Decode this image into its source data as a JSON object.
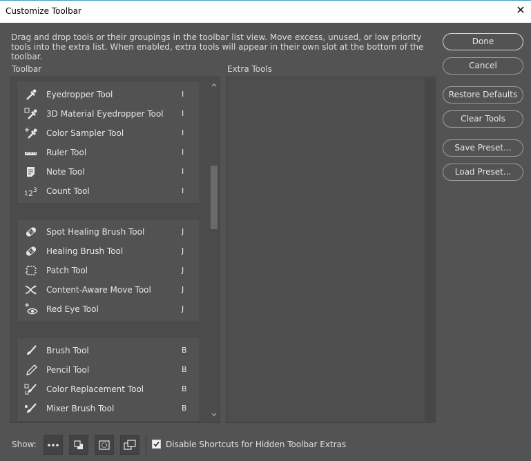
{
  "window": {
    "title": "Customize Toolbar",
    "close_glyph": "✕"
  },
  "description": "Drag and drop tools or their groupings in the toolbar list view. Move excess, unused, or low priority tools into the extra list. When enabled, extra tools will appear in their own slot at the bottom of the toolbar.",
  "panels": {
    "toolbar_label": "Toolbar",
    "extra_label": "Extra Tools"
  },
  "groups": [
    {
      "tools": [
        {
          "name": "Eyedropper Tool",
          "key": "I",
          "icon": "eyedropper-icon"
        },
        {
          "name": "3D Material Eyedropper Tool",
          "key": "I",
          "icon": "3d-material-eyedropper-icon"
        },
        {
          "name": "Color Sampler Tool",
          "key": "I",
          "icon": "color-sampler-icon"
        },
        {
          "name": "Ruler Tool",
          "key": "I",
          "icon": "ruler-icon"
        },
        {
          "name": "Note Tool",
          "key": "I",
          "icon": "note-icon"
        },
        {
          "name": "Count Tool",
          "key": "I",
          "icon": "count-icon"
        }
      ]
    },
    {
      "tools": [
        {
          "name": "Spot Healing Brush Tool",
          "key": "J",
          "icon": "spot-healing-brush-icon"
        },
        {
          "name": "Healing Brush Tool",
          "key": "J",
          "icon": "healing-brush-icon"
        },
        {
          "name": "Patch Tool",
          "key": "J",
          "icon": "patch-icon"
        },
        {
          "name": "Content-Aware Move Tool",
          "key": "J",
          "icon": "content-aware-move-icon"
        },
        {
          "name": "Red Eye Tool",
          "key": "J",
          "icon": "red-eye-icon"
        }
      ]
    },
    {
      "tools": [
        {
          "name": "Brush Tool",
          "key": "B",
          "icon": "brush-icon"
        },
        {
          "name": "Pencil Tool",
          "key": "B",
          "icon": "pencil-icon"
        },
        {
          "name": "Color Replacement Tool",
          "key": "B",
          "icon": "color-replacement-icon"
        },
        {
          "name": "Mixer Brush Tool",
          "key": "B",
          "icon": "mixer-brush-icon"
        }
      ]
    }
  ],
  "buttons": {
    "done": "Done",
    "cancel": "Cancel",
    "restore_defaults": "Restore Defaults",
    "clear_tools": "Clear Tools",
    "save_preset": "Save Preset...",
    "load_preset": "Load Preset..."
  },
  "show": {
    "label": "Show:",
    "icons": [
      "more-icon",
      "foreground-background-swatch-icon",
      "quick-mask-icon",
      "screen-mode-icon"
    ]
  },
  "disable_shortcuts": {
    "label": "Disable Shortcuts for Hidden Toolbar Extras",
    "checked": true
  }
}
